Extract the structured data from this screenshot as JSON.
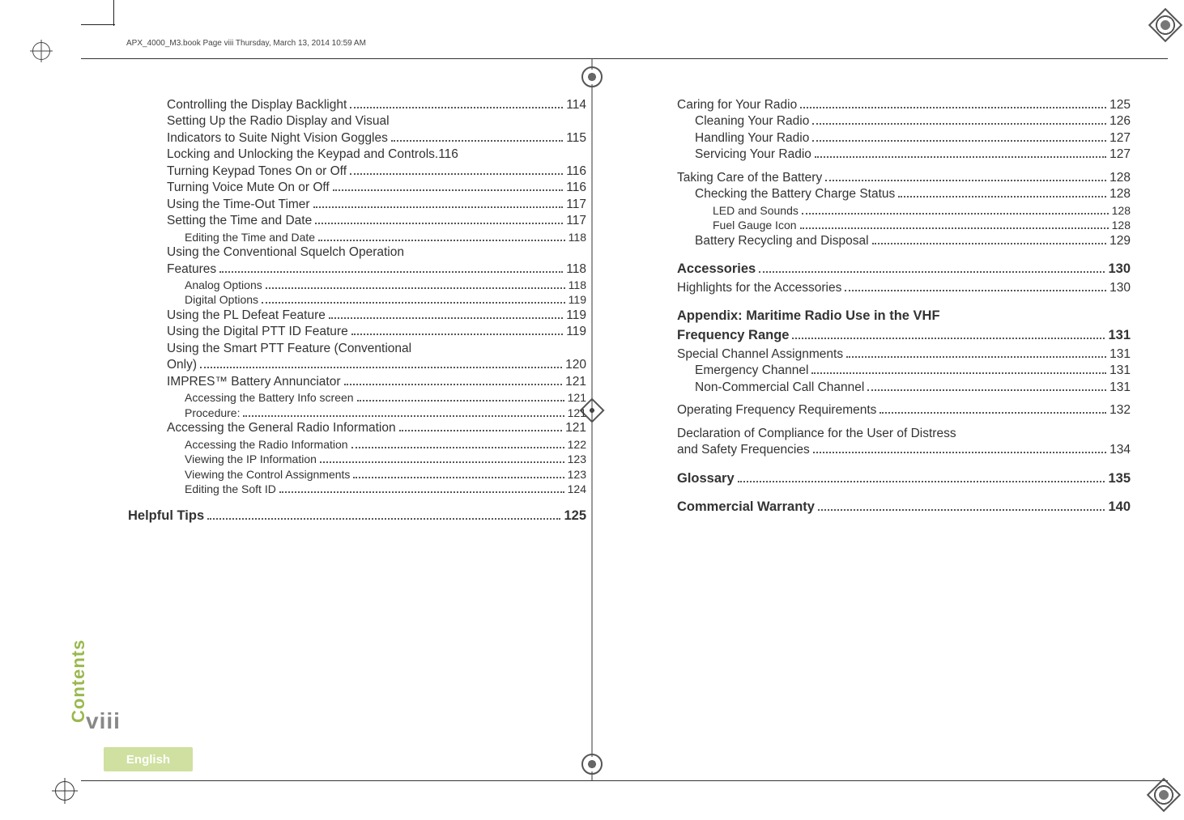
{
  "header": "APX_4000_M3.book  Page viii  Thursday, March 13, 2014  10:59 AM",
  "sidebar_label": "Contents",
  "page_number": "viii",
  "language_tab": "English",
  "left_col": [
    {
      "label": "Controlling the Display Backlight",
      "page": "114",
      "cls": "ind1"
    },
    {
      "label": "Setting Up the Radio Display and Visual",
      "nodots": true,
      "cls": "ind1"
    },
    {
      "label": "Indicators to Suite Night Vision Goggles",
      "page": "115",
      "cls": "ind1"
    },
    {
      "label": "Locking and Unlocking the Keypad and Controls",
      "page": "116",
      "cls": "ind1",
      "tight": true
    },
    {
      "label": "Turning Keypad Tones On or Off",
      "page": "116",
      "cls": "ind1"
    },
    {
      "label": "Turning Voice Mute On or Off",
      "page": "116",
      "cls": "ind1"
    },
    {
      "label": "Using the Time-Out Timer",
      "page": "117",
      "cls": "ind1"
    },
    {
      "label": "Setting the Time and Date",
      "page": "117",
      "cls": "ind1"
    },
    {
      "label": "Editing the Time and Date",
      "page": "118",
      "cls": "ind2"
    },
    {
      "label": "Using the Conventional Squelch Operation",
      "nodots": true,
      "cls": "ind1"
    },
    {
      "label": "Features",
      "page": "118",
      "cls": "ind1"
    },
    {
      "label": "Analog Options",
      "page": "118",
      "cls": "ind2"
    },
    {
      "label": "Digital Options",
      "page": "119",
      "cls": "ind2"
    },
    {
      "label": "Using the PL Defeat Feature",
      "page": "119",
      "cls": "ind1"
    },
    {
      "label": "Using the Digital PTT ID Feature",
      "page": "119",
      "cls": "ind1"
    },
    {
      "label": "Using the Smart PTT Feature (Conventional",
      "nodots": true,
      "cls": "ind1"
    },
    {
      "label": "Only)",
      "page": "120",
      "cls": "ind1"
    },
    {
      "label": "IMPRES™ Battery Annunciator",
      "page": "121",
      "cls": "ind1"
    },
    {
      "label": "Accessing the Battery Info screen",
      "page": "121",
      "cls": "ind2"
    },
    {
      "label": "Procedure:",
      "page": "121",
      "cls": "ind2"
    },
    {
      "label": "Accessing the General Radio Information",
      "page": "121",
      "cls": "ind1"
    },
    {
      "label": "Accessing the Radio Information",
      "page": "122",
      "cls": "ind2"
    },
    {
      "label": "Viewing the IP Information",
      "page": "123",
      "cls": "ind2"
    },
    {
      "label": "Viewing the Control Assignments",
      "page": "123",
      "cls": "ind2"
    },
    {
      "label": "Editing the Soft ID",
      "page": "124",
      "cls": "ind2"
    },
    {
      "label": "Helpful Tips",
      "page": "125",
      "cls": "bold",
      "outdent": true
    }
  ],
  "right_col": [
    {
      "label": "Caring for Your Radio",
      "page": "125",
      "cls": ""
    },
    {
      "label": "Cleaning Your Radio",
      "page": "126",
      "cls": "ind1"
    },
    {
      "label": "Handling Your Radio",
      "page": "127",
      "cls": "ind1"
    },
    {
      "label": "Servicing Your Radio",
      "page": "127",
      "cls": "ind1"
    },
    {
      "label": "Taking Care of the Battery",
      "page": "128",
      "cls": "",
      "gap": true
    },
    {
      "label": "Checking the Battery Charge Status",
      "page": "128",
      "cls": "ind1"
    },
    {
      "label": "LED and Sounds",
      "page": "128",
      "cls": "ind2"
    },
    {
      "label": "Fuel Gauge Icon",
      "page": "128",
      "cls": "ind2"
    },
    {
      "label": "Battery Recycling and Disposal",
      "page": "129",
      "cls": "ind1"
    },
    {
      "label": "Accessories",
      "page": "130",
      "cls": "bold"
    },
    {
      "label": "Highlights for the Accessories",
      "page": "130",
      "cls": ""
    },
    {
      "label": "Appendix: Maritime Radio Use in the VHF",
      "nodots": true,
      "cls": "bold"
    },
    {
      "label": "Frequency Range",
      "page": "131",
      "cls": "bold",
      "notop": true
    },
    {
      "label": "Special Channel Assignments",
      "page": "131",
      "cls": ""
    },
    {
      "label": "Emergency Channel",
      "page": "131",
      "cls": "ind1"
    },
    {
      "label": "Non-Commercial Call Channel",
      "page": "131",
      "cls": "ind1"
    },
    {
      "label": "Operating Frequency Requirements",
      "page": "132",
      "cls": "",
      "gap": true
    },
    {
      "label": "Declaration of Compliance for the User of Distress",
      "nodots": true,
      "cls": "",
      "gap": true
    },
    {
      "label": "and Safety Frequencies",
      "page": "134",
      "cls": "",
      "ind": "  "
    },
    {
      "label": "Glossary",
      "page": "135",
      "cls": "bold"
    },
    {
      "label": "Commercial Warranty",
      "page": "140",
      "cls": "bold"
    }
  ]
}
